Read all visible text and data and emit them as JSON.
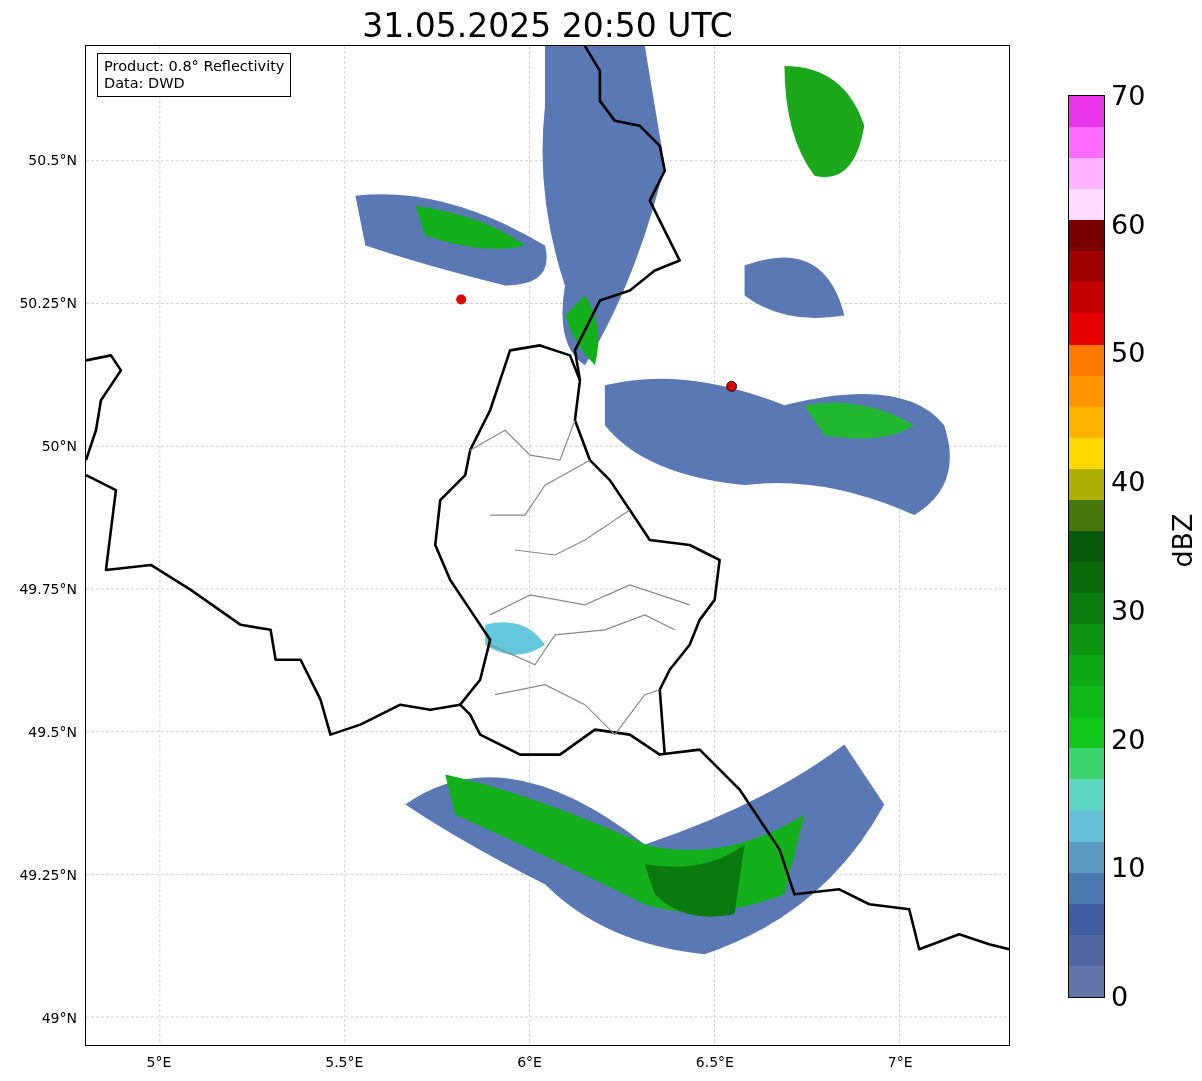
{
  "title": "31.05.2025 20:50 UTC",
  "info_box": [
    "Product: 0.8° Reflectivity",
    "Data: DWD"
  ],
  "map": {
    "lat_ticks": [
      "50.5°N",
      "50.25°N",
      "50°N",
      "49.75°N",
      "49.5°N",
      "49.25°N",
      "49°N"
    ],
    "lon_ticks": [
      "5°E",
      "5.5°E",
      "6°E",
      "6.5°E",
      "7°E"
    ]
  },
  "colorbar": {
    "label": "dBZ",
    "ticks": [
      "70",
      "60",
      "50",
      "40",
      "30",
      "20",
      "10",
      "0"
    ],
    "bins": [
      {
        "color": "#6374a8"
      },
      {
        "color": "#52679f"
      },
      {
        "color": "#425ea2"
      },
      {
        "color": "#4a78b0"
      },
      {
        "color": "#5a9ac0"
      },
      {
        "color": "#66c0d8"
      },
      {
        "color": "#5cd6c0"
      },
      {
        "color": "#3cd46c"
      },
      {
        "color": "#10c81a"
      },
      {
        "color": "#10b818"
      },
      {
        "color": "#0ea814"
      },
      {
        "color": "#0e9410"
      },
      {
        "color": "#0c7c0e"
      },
      {
        "color": "#0a6a0c"
      },
      {
        "color": "#085a0a"
      },
      {
        "color": "#48780c"
      },
      {
        "color": "#acb004"
      },
      {
        "color": "#ffd800"
      },
      {
        "color": "#ffb400"
      },
      {
        "color": "#ff9600"
      },
      {
        "color": "#ff7800"
      },
      {
        "color": "#e60000"
      },
      {
        "color": "#c40000"
      },
      {
        "color": "#a00000"
      },
      {
        "color": "#7a0000"
      },
      {
        "color": "#ffdcff"
      },
      {
        "color": "#ffb2ff"
      },
      {
        "color": "#ff6cff"
      },
      {
        "color": "#ea34ea"
      }
    ]
  }
}
